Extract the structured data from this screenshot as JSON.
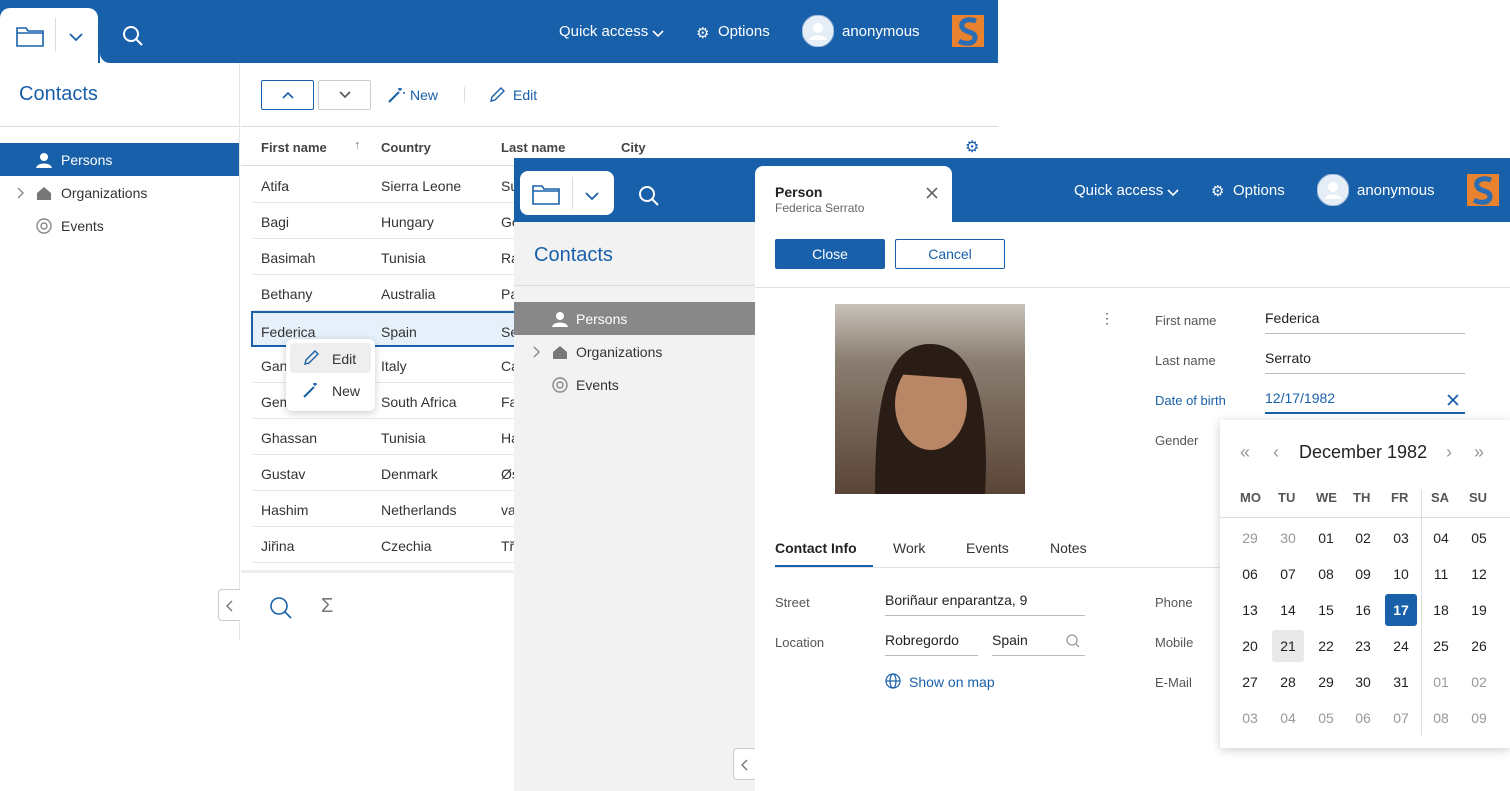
{
  "header": {
    "quick_access": "Quick access",
    "options": "Options",
    "user": "anonymous"
  },
  "sidebar": {
    "title": "Contacts",
    "items": [
      {
        "label": "Persons"
      },
      {
        "label": "Organizations"
      },
      {
        "label": "Events"
      }
    ]
  },
  "toolbar": {
    "new_label": "New",
    "edit_label": "Edit"
  },
  "table": {
    "columns": [
      "First name",
      "Country",
      "Last name",
      "City"
    ],
    "rows": [
      [
        "Atifa",
        "Sierra Leone",
        "Su"
      ],
      [
        "Bagi",
        "Hungary",
        "Ge"
      ],
      [
        "Basimah",
        "Tunisia",
        "Ra"
      ],
      [
        "Bethany",
        "Australia",
        "Pa"
      ],
      [
        "Federica",
        "Spain",
        "Se"
      ],
      [
        "Gan",
        "Italy",
        "Ca"
      ],
      [
        "Gem",
        "South Africa",
        "Fa"
      ],
      [
        "Ghassan",
        "Tunisia",
        "Ha"
      ],
      [
        "Gustav",
        "Denmark",
        "Øs"
      ],
      [
        "Hashim",
        "Netherlands",
        "va"
      ],
      [
        "Jiřina",
        "Czechia",
        "Tř"
      ]
    ]
  },
  "context_menu": {
    "edit": "Edit",
    "new": "New"
  },
  "form": {
    "tab_title": "Person",
    "tab_subtitle": "Federica Serrato",
    "close": "Close",
    "cancel": "Cancel",
    "fields": {
      "first_name_label": "First name",
      "first_name": "Federica",
      "last_name_label": "Last name",
      "last_name": "Serrato",
      "dob_label": "Date of birth",
      "dob": "12/17/1982",
      "gender_label": "Gender"
    },
    "tabs": [
      "Contact Info",
      "Work",
      "Events",
      "Notes"
    ],
    "contact": {
      "street_label": "Street",
      "street": "Boriñaur enparantza, 9",
      "location_label": "Location",
      "city": "Robregordo",
      "country": "Spain",
      "show_map": "Show on map",
      "phone_label": "Phone",
      "mobile_label": "Mobile",
      "email_label": "E-Mail"
    }
  },
  "calendar": {
    "month": "December 1982",
    "dow": [
      "MO",
      "TU",
      "WE",
      "TH",
      "FR",
      "SA",
      "SU"
    ],
    "weeks": [
      [
        "29",
        "30",
        "01",
        "02",
        "03",
        "04",
        "05"
      ],
      [
        "06",
        "07",
        "08",
        "09",
        "10",
        "11",
        "12"
      ],
      [
        "13",
        "14",
        "15",
        "16",
        "17",
        "18",
        "19"
      ],
      [
        "20",
        "21",
        "22",
        "23",
        "24",
        "25",
        "26"
      ],
      [
        "27",
        "28",
        "29",
        "30",
        "31",
        "01",
        "02"
      ],
      [
        "03",
        "04",
        "05",
        "06",
        "07",
        "08",
        "09"
      ]
    ],
    "selected": "17",
    "hover": "21"
  },
  "colors": {
    "primary": "#1960aa"
  }
}
